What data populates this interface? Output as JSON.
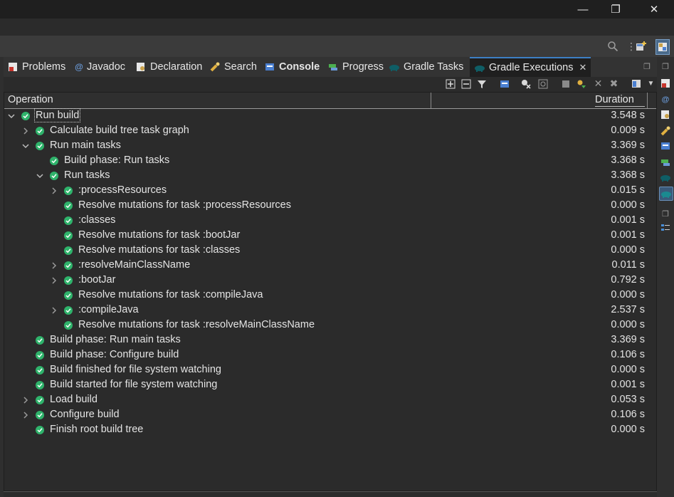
{
  "window": {
    "minimize_glyph": "—",
    "restore_glyph": "❐",
    "close_glyph": "✕"
  },
  "toolbar": {
    "search_icon": "search-icon",
    "perspective_icon": "open-perspective-icon"
  },
  "tabs": [
    {
      "label": "Problems",
      "icon": "problems-icon",
      "icon_color": "#c7352c"
    },
    {
      "label": "Javadoc",
      "icon": "javadoc-icon",
      "icon_color": "#5a86c8"
    },
    {
      "label": "Declaration",
      "icon": "declaration-icon",
      "icon_color": "#c9a14a"
    },
    {
      "label": "Search",
      "icon": "search-flashlight-icon",
      "icon_color": "#e0b040"
    },
    {
      "label": "Console",
      "icon": "console-icon",
      "icon_color": "#4a7fd0"
    },
    {
      "label": "Progress",
      "icon": "progress-icon",
      "icon_color": "#4caf50"
    },
    {
      "label": "Gradle Tasks",
      "icon": "gradle-elephant-icon",
      "icon_color": "#0f5e66"
    },
    {
      "label": "Gradle Executions",
      "icon": "gradle-elephant-icon",
      "icon_color": "#0f5e66",
      "active": true
    }
  ],
  "columns": {
    "operation": "Operation",
    "duration": "Duration"
  },
  "tree": [
    {
      "label": "Run build",
      "duration": "3.548 s",
      "depth": 0,
      "expander": "open",
      "selected": true
    },
    {
      "label": "Calculate build tree task graph",
      "duration": "0.009 s",
      "depth": 1,
      "expander": "closed"
    },
    {
      "label": "Run main tasks",
      "duration": "3.369 s",
      "depth": 1,
      "expander": "open"
    },
    {
      "label": "Build phase: Run tasks",
      "duration": "3.368 s",
      "depth": 2,
      "expander": "none"
    },
    {
      "label": "Run tasks",
      "duration": "3.368 s",
      "depth": 2,
      "expander": "open"
    },
    {
      "label": ":processResources",
      "duration": "0.015 s",
      "depth": 3,
      "expander": "closed"
    },
    {
      "label": "Resolve mutations for task :processResources",
      "duration": "0.000 s",
      "depth": 3,
      "expander": "none"
    },
    {
      "label": ":classes",
      "duration": "0.001 s",
      "depth": 3,
      "expander": "none"
    },
    {
      "label": "Resolve mutations for task :bootJar",
      "duration": "0.001 s",
      "depth": 3,
      "expander": "none"
    },
    {
      "label": "Resolve mutations for task :classes",
      "duration": "0.000 s",
      "depth": 3,
      "expander": "none"
    },
    {
      "label": ":resolveMainClassName",
      "duration": "0.011 s",
      "depth": 3,
      "expander": "closed"
    },
    {
      "label": ":bootJar",
      "duration": "0.792 s",
      "depth": 3,
      "expander": "closed"
    },
    {
      "label": "Resolve mutations for task :compileJava",
      "duration": "0.000 s",
      "depth": 3,
      "expander": "none"
    },
    {
      "label": ":compileJava",
      "duration": "2.537 s",
      "depth": 3,
      "expander": "closed"
    },
    {
      "label": "Resolve mutations for task :resolveMainClassName",
      "duration": "0.000 s",
      "depth": 3,
      "expander": "none"
    },
    {
      "label": "Build phase: Run main tasks",
      "duration": "3.369 s",
      "depth": 1,
      "expander": "none"
    },
    {
      "label": "Build phase: Configure build",
      "duration": "0.106 s",
      "depth": 1,
      "expander": "none"
    },
    {
      "label": "Build finished for file system watching",
      "duration": "0.000 s",
      "depth": 1,
      "expander": "none"
    },
    {
      "label": "Build started for file system watching",
      "duration": "0.001 s",
      "depth": 1,
      "expander": "none"
    },
    {
      "label": "Load build",
      "duration": "0.053 s",
      "depth": 1,
      "expander": "closed"
    },
    {
      "label": "Configure build",
      "duration": "0.106 s",
      "depth": 1,
      "expander": "closed"
    },
    {
      "label": "Finish root build tree",
      "duration": "0.000 s",
      "depth": 1,
      "expander": "none"
    }
  ],
  "colors": {
    "success": "#2fb36b",
    "active_tab_border": "#3d7fc4"
  }
}
